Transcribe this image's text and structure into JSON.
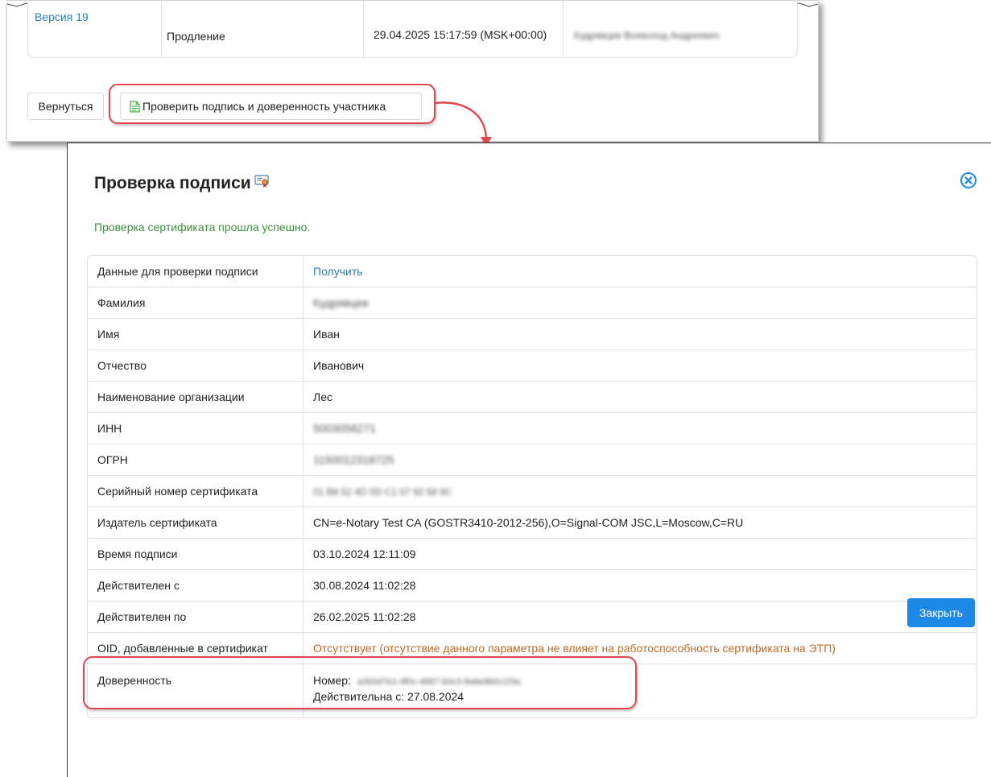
{
  "top_panel": {
    "row": {
      "version_link": "Версия 19",
      "action": "Продление",
      "datetime": "29.04.2025 15:17:59 (MSK+00:00)",
      "user_name_blurred": "Кудрявцев Всеволод Андреевич"
    },
    "back_button": "Вернуться",
    "check_button": "Проверить подпись и доверенность участника",
    "check_button_icon": "file-text-icon"
  },
  "modal": {
    "title": "Проверка подписи",
    "title_icon": "certificate-icon",
    "close_icon": "close-circle-icon",
    "success_message": "Проверка сертификата прошла успешно.",
    "rows": [
      {
        "label": "Данные для проверки подписи",
        "value": "Получить"
      },
      {
        "label": "Фамилия",
        "value": "Кудрявцев"
      },
      {
        "label": "Имя",
        "value": "Иван"
      },
      {
        "label": "Отчество",
        "value": "Иванович"
      },
      {
        "label": "Наименование организации",
        "value": "Лес"
      },
      {
        "label": "ИНН",
        "value": "5003056271"
      },
      {
        "label": "ОГРН",
        "value": "1150012318725"
      },
      {
        "label": "Серийный номер сертификата",
        "value": "01 B8 52 4D 0D C1 07 92 58 6C"
      },
      {
        "label": "Издатель сертификата",
        "value": "CN=e-Notary Test CA (GOSTR3410-2012-256),O=Signal-COM JSC,L=Moscow,C=RU"
      },
      {
        "label": "Время подписи",
        "value": "03.10.2024 12:11:09"
      },
      {
        "label": "Действителен с",
        "value": "30.08.2024 11:02:28"
      },
      {
        "label": "Действителен по",
        "value": "26.02.2025 11:02:28"
      },
      {
        "label": "OID, добавленные в сертификат",
        "value": "Отсутствует (отсутствие данного параметра не влияет на работоспособность сертификата на ЭТП)"
      },
      {
        "label": "Доверенность",
        "number_label": "Номер:",
        "number_value": "a2b5d7e1-4f0c-4887-b0c3-8a6e9b0c1f3a",
        "valid_from": "Действительна с: 27.08.2024"
      }
    ],
    "close_button": "Закрыть"
  },
  "colors": {
    "link": "#2a7fb8",
    "success": "#3e8e3e",
    "warning": "#c06a25",
    "highlight": "#e0474c",
    "primary": "#1e88e5"
  }
}
